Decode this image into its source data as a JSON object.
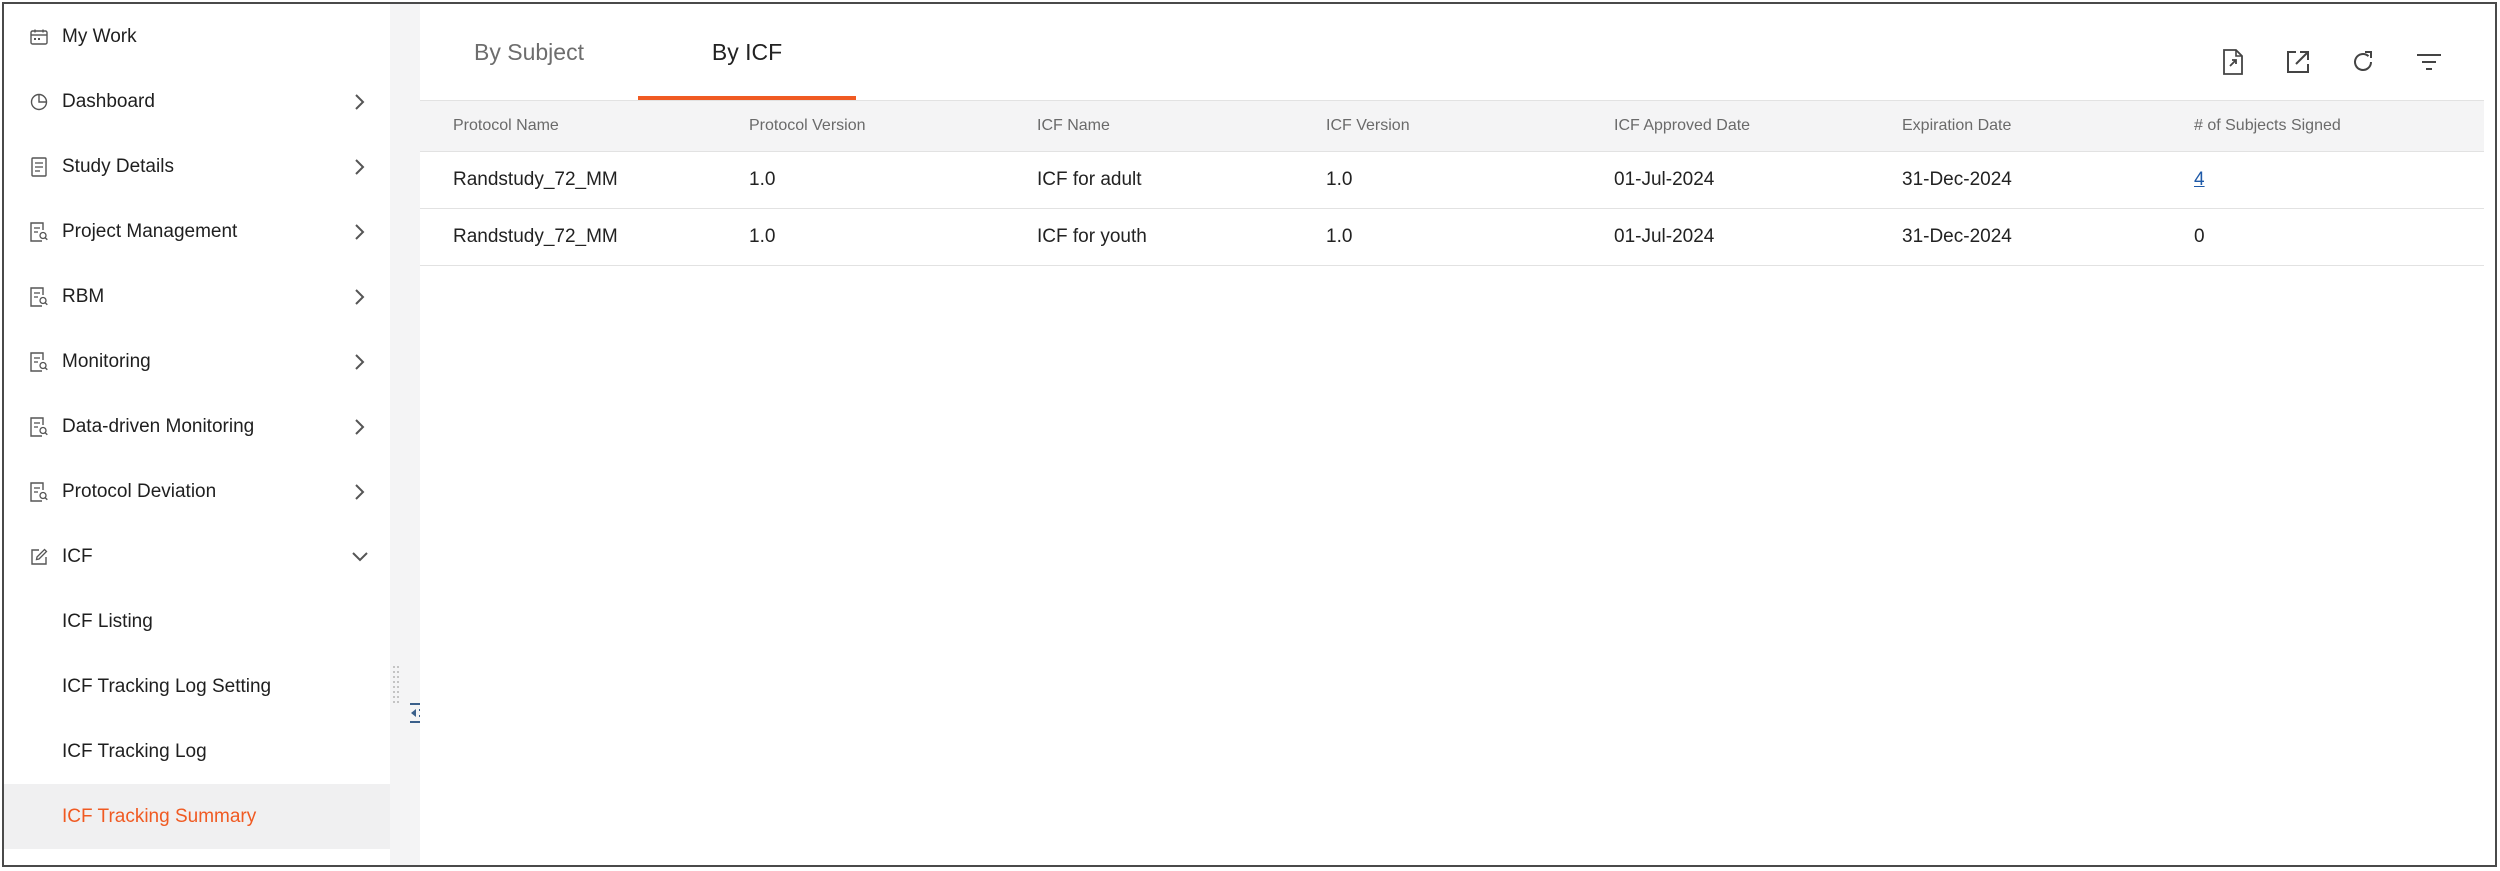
{
  "sidebar": {
    "items": [
      {
        "label": "My Work",
        "icon": "calendar-icon",
        "chevron": "none"
      },
      {
        "label": "Dashboard",
        "icon": "pie-chart-icon",
        "chevron": "right"
      },
      {
        "label": "Study Details",
        "icon": "document-icon",
        "chevron": "right"
      },
      {
        "label": "Project Management",
        "icon": "document-search-icon",
        "chevron": "right"
      },
      {
        "label": "RBM",
        "icon": "document-search-icon",
        "chevron": "right"
      },
      {
        "label": "Monitoring",
        "icon": "document-search-icon",
        "chevron": "right"
      },
      {
        "label": "Data-driven Monitoring",
        "icon": "document-search-icon",
        "chevron": "right"
      },
      {
        "label": "Protocol Deviation",
        "icon": "document-search-icon",
        "chevron": "right"
      },
      {
        "label": "ICF",
        "icon": "edit-icon",
        "chevron": "down"
      }
    ],
    "sub_items": [
      {
        "label": "ICF Listing"
      },
      {
        "label": "ICF Tracking Log Setting"
      },
      {
        "label": "ICF Tracking Log"
      },
      {
        "label": "ICF Tracking Summary",
        "active": true
      }
    ]
  },
  "tabs": [
    {
      "label": "By Subject",
      "active": false
    },
    {
      "label": "By ICF",
      "active": true
    }
  ],
  "toolbar": {
    "icons": [
      "export-document-icon",
      "open-external-icon",
      "refresh-icon",
      "filter-icon"
    ]
  },
  "table": {
    "columns": [
      "Protocol Name",
      "Protocol Version",
      "ICF Name",
      "ICF Version",
      "ICF Approved Date",
      "Expiration Date",
      "# of Subjects Signed"
    ],
    "rows": [
      [
        "Randstudy_72_MM",
        "1.0",
        "ICF for adult",
        "1.0",
        "01-Jul-2024",
        "31-Dec-2024",
        "4"
      ],
      [
        "Randstudy_72_MM",
        "1.0",
        "ICF for youth",
        "1.0",
        "01-Jul-2024",
        "31-Dec-2024",
        "0"
      ]
    ]
  },
  "colors": {
    "accent": "#f05a22",
    "link": "#1f5aa8",
    "active_bg": "#f0f0f1",
    "header_bg": "#f4f4f5"
  }
}
